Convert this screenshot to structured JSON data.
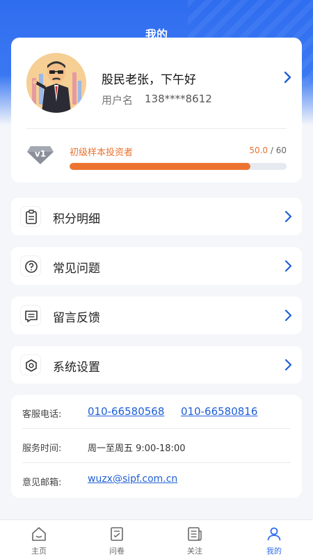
{
  "header": {
    "title": "我的"
  },
  "profile": {
    "greeting": "股民老张，下午好",
    "username_label": "用户名",
    "username_value": "138****8612"
  },
  "level": {
    "badge": "v1",
    "name": "初级样本投资者",
    "current": "50.0",
    "separator": " / ",
    "max": "60",
    "progress_fraction": 0.833
  },
  "menu": [
    {
      "label": "积分明细",
      "icon": "points-list-icon"
    },
    {
      "label": "常见问题",
      "icon": "question-icon"
    },
    {
      "label": "留言反馈",
      "icon": "message-icon"
    },
    {
      "label": "系统设置",
      "icon": "settings-icon"
    }
  ],
  "contact": {
    "phone_label": "客服电话:",
    "phone1": "010-66580568",
    "phone2": "010-66580816",
    "hours_label": "服务时间:",
    "hours_value": "周一至周五 9:00-18:00",
    "email_label": "意见邮箱:",
    "email_value": "wuzx@sipf.com.cn"
  },
  "tabbar": [
    {
      "label": "主页",
      "icon": "home-icon",
      "active": false
    },
    {
      "label": "问卷",
      "icon": "survey-icon",
      "active": false
    },
    {
      "label": "关注",
      "icon": "news-icon",
      "active": false
    },
    {
      "label": "我的",
      "icon": "user-icon",
      "active": true
    }
  ],
  "colors": {
    "accent": "#2f6df0",
    "progress": "#ed7430",
    "link": "#1f5fd6"
  }
}
